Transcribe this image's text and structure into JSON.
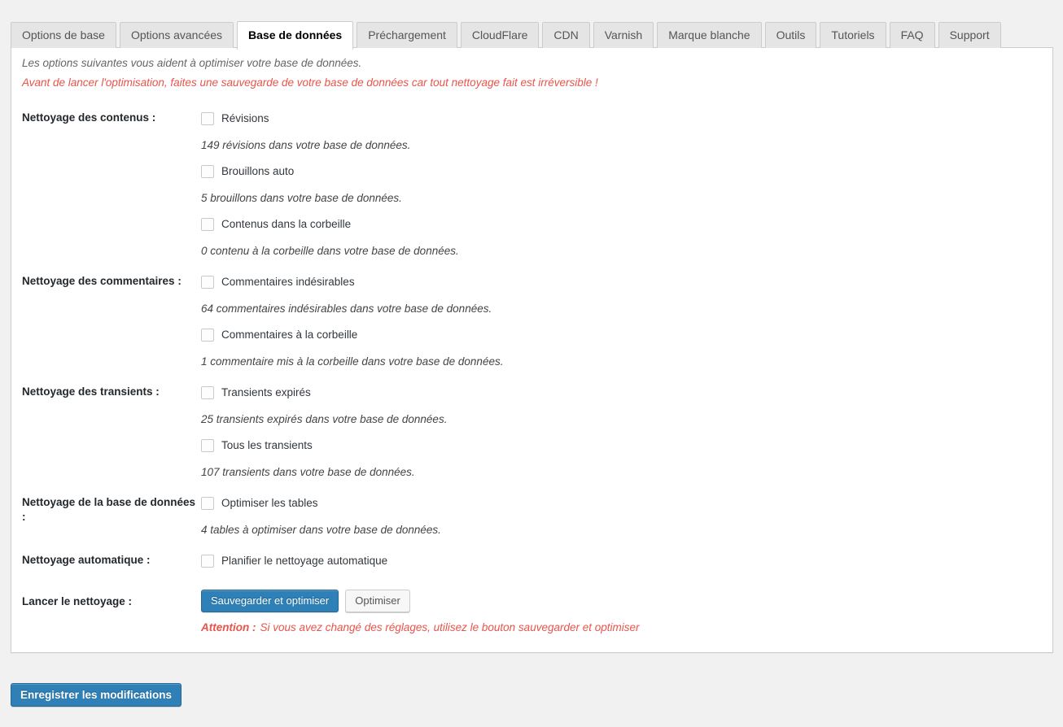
{
  "tabs": [
    {
      "label": "Options de base",
      "active": false
    },
    {
      "label": "Options avancées",
      "active": false
    },
    {
      "label": "Base de données",
      "active": true
    },
    {
      "label": "Préchargement",
      "active": false
    },
    {
      "label": "CloudFlare",
      "active": false
    },
    {
      "label": "CDN",
      "active": false
    },
    {
      "label": "Varnish",
      "active": false
    },
    {
      "label": "Marque blanche",
      "active": false
    },
    {
      "label": "Outils",
      "active": false
    },
    {
      "label": "Tutoriels",
      "active": false
    },
    {
      "label": "FAQ",
      "active": false
    },
    {
      "label": "Support",
      "active": false
    }
  ],
  "panel": {
    "intro": "Les options suivantes vous aident à optimiser votre base de données.",
    "warning": "Avant de lancer l'optimisation, faites une sauvegarde de votre base de données car tout nettoyage fait est irréversible !"
  },
  "sections": [
    {
      "label": "Nettoyage des contenus :",
      "items": [
        {
          "checkbox": "Révisions",
          "checked": false,
          "desc": "149 révisions dans votre base de données."
        },
        {
          "checkbox": "Brouillons auto",
          "checked": false,
          "desc": "5 brouillons dans votre base de données."
        },
        {
          "checkbox": "Contenus dans la corbeille",
          "checked": false,
          "desc": "0 contenu à la corbeille dans votre base de données."
        }
      ]
    },
    {
      "label": "Nettoyage des commentaires :",
      "items": [
        {
          "checkbox": "Commentaires indésirables",
          "checked": false,
          "desc": "64 commentaires indésirables dans votre base de données."
        },
        {
          "checkbox": "Commentaires à la corbeille",
          "checked": false,
          "desc": "1 commentaire mis à la corbeille dans votre base de données."
        }
      ]
    },
    {
      "label": "Nettoyage des transients :",
      "items": [
        {
          "checkbox": "Transients expirés",
          "checked": false,
          "desc": "25 transients expirés dans votre base de données."
        },
        {
          "checkbox": "Tous les transients",
          "checked": false,
          "desc": "107 transients dans votre base de données."
        }
      ]
    },
    {
      "label": "Nettoyage de la base de données :",
      "items": [
        {
          "checkbox": "Optimiser les tables",
          "checked": false,
          "desc": "4 tables à optimiser dans votre base de données."
        }
      ]
    },
    {
      "label": "Nettoyage automatique :",
      "items": [
        {
          "checkbox": "Planifier le nettoyage automatique",
          "checked": false,
          "desc": ""
        }
      ]
    }
  ],
  "run": {
    "label": "Lancer le nettoyage :",
    "primary_button": "Sauvegarder et optimiser",
    "secondary_button": "Optimiser",
    "attention_prefix": "Attention :",
    "attention_text": "Si vous avez changé des réglages, utilisez le bouton sauvegarder et optimiser"
  },
  "footer": {
    "save_label": "Enregistrer les modifications"
  },
  "colors": {
    "primary_button": "#2e80b6",
    "warning_text": "#e8544b",
    "page_background": "#f1f1f1",
    "panel_background": "#ffffff",
    "tab_inactive": "#e5e5e5"
  }
}
